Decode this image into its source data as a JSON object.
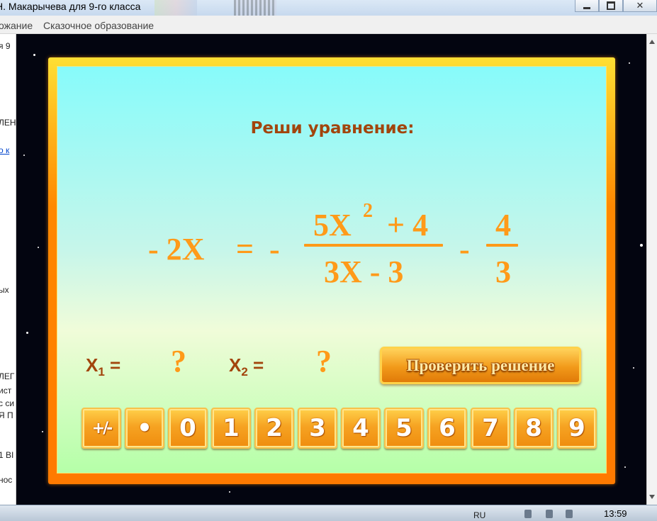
{
  "window": {
    "title": "Н. Макарычева для 9-го класса",
    "buttons": [
      "minimize",
      "maximize",
      "close"
    ]
  },
  "menu": {
    "items": [
      "ожание",
      "Сказочное образование"
    ]
  },
  "doc_fragments": [
    {
      "text": "я 9",
      "link": false
    },
    {
      "text": "ЛЕН",
      "link": false
    },
    {
      "text": "о к",
      "link": true
    },
    {
      "text": "ых",
      "link": false
    },
    {
      "text": "ЛЕГ",
      "link": false
    },
    {
      "text": "ист",
      "link": false
    },
    {
      "text": "с си",
      "link": false
    },
    {
      "text": "Я П",
      "link": false
    },
    {
      "text": "1 ВІ",
      "link": false
    },
    {
      "text": "нос",
      "link": false
    }
  ],
  "task": {
    "prompt": "Реши уравнение:",
    "equation": {
      "lhs": "- 2X",
      "equals": "=",
      "minus1": "-",
      "num_base": "5X",
      "num_exp": "2",
      "num_tail": "+ 4",
      "den": "3X - 3",
      "minus2": "-",
      "num2": "4",
      "den2": "3"
    },
    "roots": [
      {
        "label": "X",
        "sub": "1",
        "eq": "=",
        "value": "?"
      },
      {
        "label": "X",
        "sub": "2",
        "eq": "=",
        "value": "?"
      }
    ],
    "check_button": "Проверить решение"
  },
  "keypad": [
    "+/-",
    "•",
    "0",
    "1",
    "2",
    "3",
    "4",
    "5",
    "6",
    "7",
    "8",
    "9"
  ],
  "taskbar": {
    "lang": "RU",
    "clock": "13:59"
  },
  "colors": {
    "accent": "#ff9a19",
    "prompt": "#a2450d",
    "frame": "#ff8800"
  }
}
